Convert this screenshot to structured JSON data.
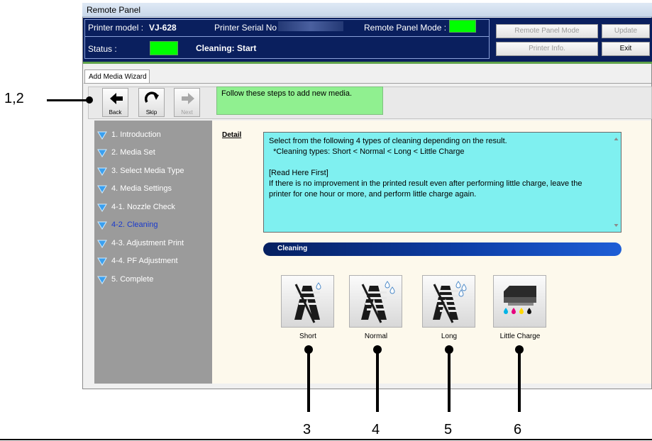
{
  "window": {
    "title": "Remote Panel"
  },
  "header": {
    "model_label": "Printer model :",
    "model_value": "VJ-628",
    "serial_label": "Printer Serial No",
    "mode_label": "Remote Panel Mode :",
    "status_label": "Status :",
    "status_value": "Cleaning: Start",
    "buttons": {
      "remote_panel_mode": "Remote Panel Mode",
      "update": "Update",
      "printer_info": "Printer Info.",
      "exit": "Exit"
    },
    "indicator_color": "#00ff00"
  },
  "tab": {
    "label": "Add Media Wizard"
  },
  "toolbar": {
    "back": "Back",
    "skip": "Skip",
    "next": "Next"
  },
  "message": "Follow these steps to add new media.",
  "sidebar": {
    "items": [
      {
        "label": "1. Introduction"
      },
      {
        "label": "2. Media Set"
      },
      {
        "label": "3. Select Media Type"
      },
      {
        "label": "4. Media Settings"
      },
      {
        "label": "4-1. Nozzle Check"
      },
      {
        "label": "4-2. Cleaning"
      },
      {
        "label": "4-3. Adjustment Print"
      },
      {
        "label": "4-4. PF Adjustment"
      },
      {
        "label": "5. Complete"
      }
    ],
    "current_index": 5
  },
  "detail": {
    "label": "Detail",
    "lines": [
      "Select from the following 4 types of cleaning depending on the result.",
      "  *Cleaning types: Short < Normal < Long < Little Charge",
      "",
      "[Read Here First]",
      "If there is no improvement in the printed result even after performing little charge, leave the",
      "printer for one hour or more, and perform little charge again."
    ]
  },
  "section": {
    "title": "Cleaning"
  },
  "cleaning_buttons": [
    {
      "label": "Short",
      "icon": "short-cleaning-icon"
    },
    {
      "label": "Normal",
      "icon": "normal-cleaning-icon"
    },
    {
      "label": "Long",
      "icon": "long-cleaning-icon"
    },
    {
      "label": "Little Charge",
      "icon": "little-charge-icon"
    }
  ],
  "annotations": {
    "toolbar_callout": "1,2",
    "callouts": [
      "3",
      "4",
      "5",
      "6"
    ]
  }
}
